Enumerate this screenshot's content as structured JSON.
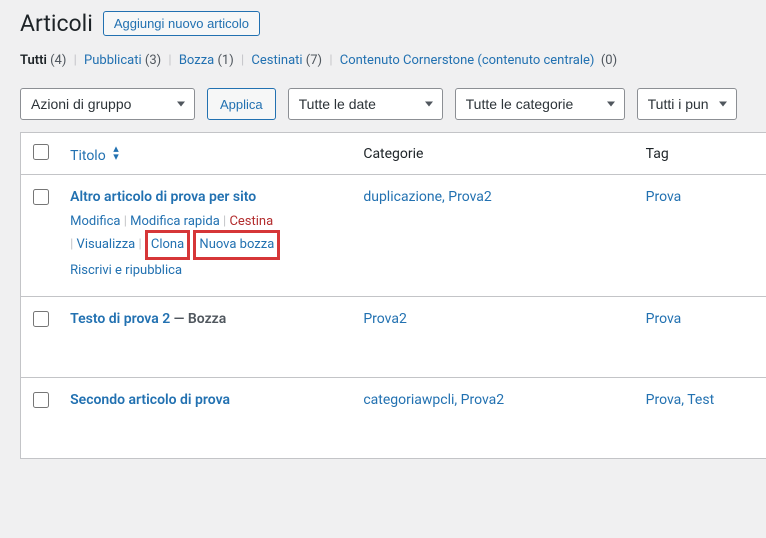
{
  "header": {
    "title": "Articoli",
    "add_new": "Aggiungi nuovo articolo"
  },
  "filters": {
    "all": {
      "label": "Tutti",
      "count": "(4)"
    },
    "published": {
      "label": "Pubblicati",
      "count": "(3)"
    },
    "draft": {
      "label": "Bozza",
      "count": "(1)"
    },
    "trash": {
      "label": "Cestinati",
      "count": "(7)"
    },
    "cornerstone": {
      "label": "Contenuto Cornerstone (contenuto centrale)",
      "count": "(0)"
    }
  },
  "tablenav": {
    "bulk_actions": "Azioni di gruppo",
    "apply": "Applica",
    "dates": "Tutte le date",
    "categories": "Tutte le categorie",
    "seo": "Tutti i pun"
  },
  "columns": {
    "title": "Titolo",
    "categories": "Categorie",
    "tags": "Tag"
  },
  "rows": [
    {
      "title": "Altro articolo di prova per sito",
      "suffix": "",
      "categories": "duplicazione, Prova2",
      "tags": "Prova",
      "actions": {
        "edit": "Modifica",
        "quick_edit": "Modifica rapida",
        "trash": "Cestina",
        "view": "Visualizza",
        "clone": "Clona",
        "new_draft": "Nuova bozza",
        "rewrite": "Riscrivi e ripubblica"
      },
      "show_actions": true
    },
    {
      "title": "Testo di prova 2",
      "suffix": " — Bozza",
      "categories": "Prova2",
      "tags": "Prova",
      "show_actions": false
    },
    {
      "title": "Secondo articolo di prova",
      "suffix": "",
      "categories": "categoriawpcli, Prova2",
      "tags": "Prova, Test",
      "show_actions": false
    }
  ]
}
